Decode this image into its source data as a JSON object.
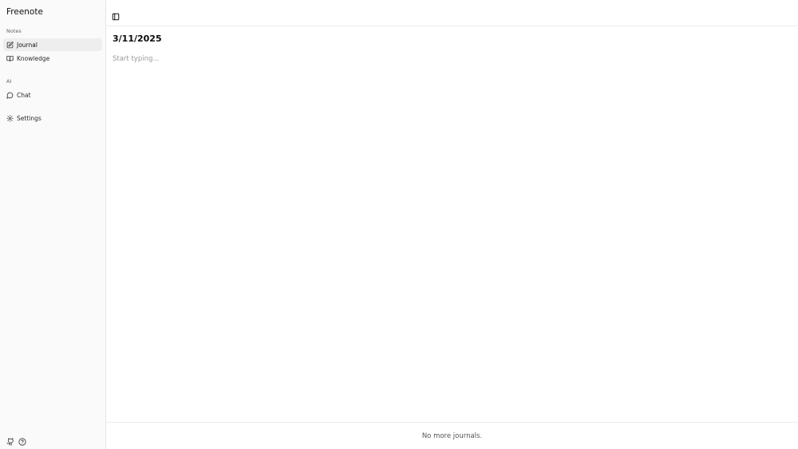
{
  "app": {
    "title": "Freenote"
  },
  "sidebar": {
    "notes_label": "Notes",
    "notes_items": [
      {
        "label": "Journal",
        "icon": "edit-note-icon",
        "active": true
      },
      {
        "label": "Knowledge",
        "icon": "book-icon",
        "active": false
      }
    ],
    "ai_label": "AI",
    "ai_items": [
      {
        "label": "Chat",
        "icon": "chat-bubble-icon",
        "active": false
      }
    ],
    "settings": {
      "label": "Settings",
      "icon": "gear-icon"
    },
    "bottom_icons": [
      "github-icon",
      "help-circle-icon"
    ]
  },
  "main": {
    "journal_date": "3/11/2025",
    "editor_placeholder": "Start typing...",
    "editor_value": "",
    "footer_text": "No more journals."
  },
  "colors": {
    "sidebar_bg": "#fafafa",
    "active_item_bg": "#eeeeee",
    "border": "#e5e5e5"
  }
}
